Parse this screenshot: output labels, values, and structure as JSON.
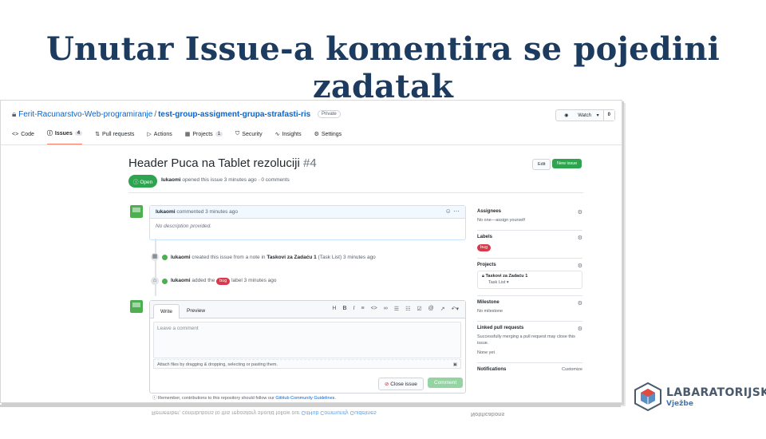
{
  "slide": {
    "title": "Unutar Issue-a komentira se pojedini zadatak"
  },
  "repo": {
    "owner": "Ferit-Racunarstvo-Web-programiranje",
    "separator": "/",
    "name": "test-group-assigment-grupa-strafasti-ris",
    "visibility": "Private"
  },
  "watch": {
    "label": "Watch",
    "count": "0"
  },
  "tabs": [
    {
      "icon": "code-icon",
      "label": "Code"
    },
    {
      "icon": "issue-icon",
      "label": "Issues",
      "badge": "4",
      "active": true
    },
    {
      "icon": "pull-request-icon",
      "label": "Pull requests"
    },
    {
      "icon": "actions-icon",
      "label": "Actions"
    },
    {
      "icon": "project-icon",
      "label": "Projects",
      "badge": "1"
    },
    {
      "icon": "security-icon",
      "label": "Security"
    },
    {
      "icon": "insights-icon",
      "label": "Insights"
    },
    {
      "icon": "settings-icon",
      "label": "Settings"
    }
  ],
  "issue": {
    "title": "Header Puca na Tablet rezoluciji",
    "number": "#4",
    "state": "Open",
    "author": "lukaomi",
    "opened_text": "opened this issue 3 minutes ago · 0 comments",
    "edit_label": "Edit",
    "new_issue_label": "New issue"
  },
  "comment": {
    "author": "lukaomi",
    "meta": "commented 3 minutes ago",
    "body": "No description provided."
  },
  "timeline": {
    "created": {
      "author": "lukaomi",
      "pre": "created this issue from a note in",
      "project": "Taskovi za Zadaću 1",
      "column": "(Task List)",
      "time": "3 minutes ago"
    },
    "labeled": {
      "author": "lukaomi",
      "pre": "added the",
      "label": "bug",
      "post": "label 3 minutes ago"
    }
  },
  "editor": {
    "tab_write": "Write",
    "tab_preview": "Preview",
    "placeholder": "Leave a comment",
    "attach_text": "Attach files by dragging & dropping, selecting or pasting them.",
    "close_label": "Close issue",
    "comment_label": "Comment"
  },
  "remember": {
    "text": "Remember, contributions to this repository should follow our",
    "link": "GitHub Community Guidelines",
    "end": "."
  },
  "sidebar": {
    "assignees": {
      "title": "Assignees",
      "text": "No one—assign yourself"
    },
    "labels": {
      "title": "Labels",
      "label": "bug"
    },
    "projects": {
      "title": "Projects",
      "name": "Taskovi za Zadaću 1",
      "column": "Task List ▾"
    },
    "milestone": {
      "title": "Milestone",
      "text": "No milestone"
    },
    "linked": {
      "title": "Linked pull requests",
      "text": "Successfully merging a pull request may close this issue.",
      "none": "None yet"
    },
    "notifications": {
      "title": "Notifications",
      "customize": "Customize"
    }
  },
  "logo": {
    "line1": "LABARATORIJSKE",
    "line2": "Vježbe"
  },
  "colors": {
    "title": "#1c3b5e",
    "green": "#2ea44f",
    "bug": "#d73a4a",
    "link": "#0366d6"
  }
}
